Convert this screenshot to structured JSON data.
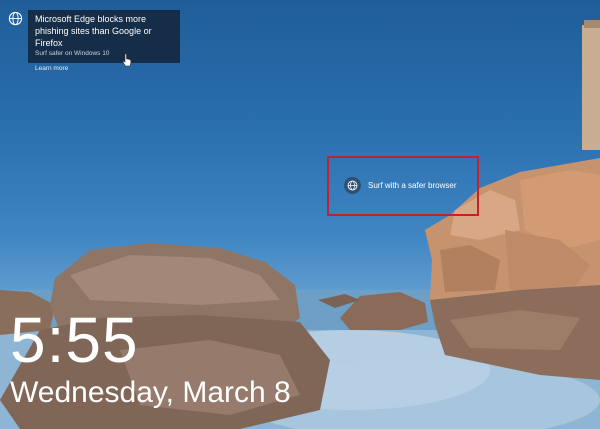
{
  "notification": {
    "title": "Microsoft Edge blocks more phishing sites than Google or Firefox",
    "subtitle": "Surf safer on Windows 10",
    "link_label": "Learn more",
    "icon": "globe-icon"
  },
  "hotspot": {
    "label": "Surf with a safer browser",
    "icon": "globe-icon",
    "highlight_color": "#c3212b"
  },
  "lock_screen": {
    "time": "5:55",
    "date": "Wednesday, March 8"
  }
}
